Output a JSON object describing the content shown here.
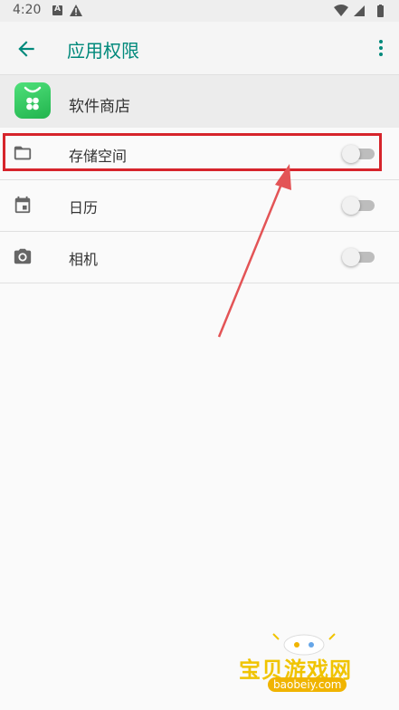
{
  "status_bar": {
    "time": "4:20",
    "notif_a": "A"
  },
  "toolbar": {
    "title": "应用权限"
  },
  "app": {
    "name": "软件商店"
  },
  "permissions": [
    {
      "label": "存储空间",
      "enabled": false
    },
    {
      "label": "日历",
      "enabled": false
    },
    {
      "label": "相机",
      "enabled": false
    }
  ],
  "watermark": {
    "brand": "宝贝游戏网",
    "url": "baobeiy.com"
  },
  "colors": {
    "accent": "#00897b",
    "annotation": "#d6242b"
  }
}
